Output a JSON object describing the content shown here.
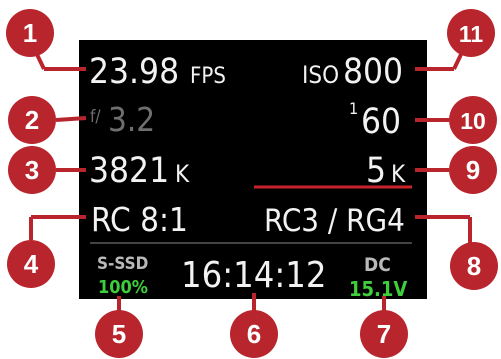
{
  "display": {
    "frame_rate": {
      "value": "23.98",
      "unit": "FPS"
    },
    "iris": {
      "prefix": "f/",
      "value": "3.2"
    },
    "resolution": {
      "value": "3821",
      "unit": "K"
    },
    "compression": "RC 8:1",
    "media": {
      "label": "S-SSD",
      "value": "100%"
    },
    "timecode": "16:14:12",
    "power": {
      "label": "DC",
      "value": "15.1V"
    },
    "iso": {
      "label": "ISO",
      "value": "800"
    },
    "shutter": {
      "numerator": "1",
      "denominator": "60"
    },
    "resolution_mode": {
      "value": "5",
      "unit": "K"
    },
    "color_settings": "RC3 / RG4"
  },
  "callouts": [
    "1",
    "2",
    "3",
    "4",
    "5",
    "6",
    "7",
    "8",
    "9",
    "10",
    "11"
  ],
  "colors": {
    "screen": "#000000",
    "callout": "#b8252c",
    "ok_value": "#3fcf3c",
    "text": "#f2f2f2",
    "dim_text": "#6f6f6f"
  }
}
